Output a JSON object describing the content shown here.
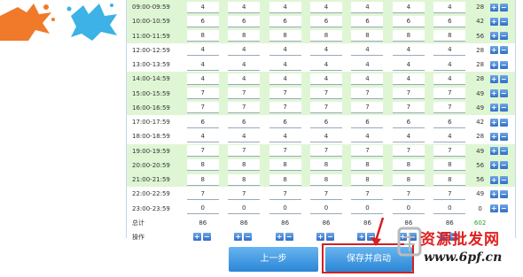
{
  "rows": [
    {
      "time": "09:00-09:59",
      "values": [
        "4",
        "4",
        "4",
        "4",
        "4",
        "4",
        "4"
      ],
      "total": "28",
      "highlight": true
    },
    {
      "time": "10:00-10:59",
      "values": [
        "6",
        "6",
        "6",
        "6",
        "6",
        "6",
        "6"
      ],
      "total": "42",
      "highlight": true
    },
    {
      "time": "11:00-11:59",
      "values": [
        "8",
        "8",
        "8",
        "8",
        "8",
        "8",
        "8"
      ],
      "total": "56",
      "highlight": true
    },
    {
      "time": "12:00-12:59",
      "values": [
        "4",
        "4",
        "4",
        "4",
        "4",
        "4",
        "4"
      ],
      "total": "28",
      "highlight": false
    },
    {
      "time": "13:00-13:59",
      "values": [
        "4",
        "4",
        "4",
        "4",
        "4",
        "4",
        "4"
      ],
      "total": "28",
      "highlight": false
    },
    {
      "time": "14:00-14:59",
      "values": [
        "4",
        "4",
        "4",
        "4",
        "4",
        "4",
        "4"
      ],
      "total": "28",
      "highlight": true
    },
    {
      "time": "15:00-15:59",
      "values": [
        "7",
        "7",
        "7",
        "7",
        "7",
        "7",
        "7"
      ],
      "total": "49",
      "highlight": true
    },
    {
      "time": "16:00-16:59",
      "values": [
        "7",
        "7",
        "7",
        "7",
        "7",
        "7",
        "7"
      ],
      "total": "49",
      "highlight": true
    },
    {
      "time": "17:00-17:59",
      "values": [
        "6",
        "6",
        "6",
        "6",
        "6",
        "6",
        "6"
      ],
      "total": "42",
      "highlight": false
    },
    {
      "time": "18:00-18:59",
      "values": [
        "4",
        "4",
        "4",
        "4",
        "4",
        "4",
        "4"
      ],
      "total": "28",
      "highlight": false
    },
    {
      "time": "19:00-19:59",
      "values": [
        "7",
        "7",
        "7",
        "7",
        "7",
        "7",
        "7"
      ],
      "total": "49",
      "highlight": true
    },
    {
      "time": "20:00-20:59",
      "values": [
        "8",
        "8",
        "8",
        "8",
        "8",
        "8",
        "8"
      ],
      "total": "56",
      "highlight": true
    },
    {
      "time": "21:00-21:59",
      "values": [
        "8",
        "8",
        "8",
        "8",
        "8",
        "8",
        "8"
      ],
      "total": "56",
      "highlight": true
    },
    {
      "time": "22:00-22:59",
      "values": [
        "7",
        "7",
        "7",
        "7",
        "7",
        "7",
        "7"
      ],
      "total": "49",
      "highlight": false
    },
    {
      "time": "23:00-23:59",
      "values": [
        "0",
        "0",
        "0",
        "0",
        "0",
        "0",
        "0"
      ],
      "total": "0",
      "highlight": false
    }
  ],
  "summary": {
    "label": "总计",
    "values": [
      "86",
      "86",
      "86",
      "86",
      "86",
      "86",
      "86"
    ],
    "grand_total": "602"
  },
  "ops": {
    "label": "操作",
    "plus": "+",
    "minus": "−"
  },
  "buttons": {
    "prev": "上一步",
    "save": "保存并启动"
  },
  "watermark": {
    "text": "资源批发网",
    "url": "www.6pf.cn"
  },
  "colors": {
    "row_highlight": "#dff6d5",
    "button_blue": "#2a86d6",
    "red_box": "#d42020",
    "grand_total_green": "#2a9a2a"
  }
}
